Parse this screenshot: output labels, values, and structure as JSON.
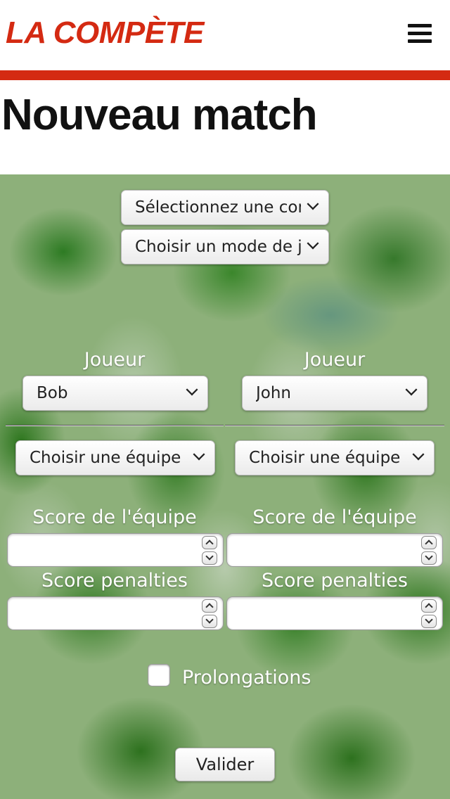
{
  "header": {
    "logo_text": "LA COMPÈTE",
    "menu_icon": "hamburger-menu-icon",
    "accent_color": "#d42a12"
  },
  "page": {
    "title": "Nouveau match"
  },
  "form": {
    "competition_select": {
      "value": "Sélectionnez une compétition"
    },
    "mode_select": {
      "value": "Choisir un mode de jeu"
    },
    "player_left": {
      "label": "Joueur",
      "value": "Bob"
    },
    "player_right": {
      "label": "Joueur",
      "value": "John"
    },
    "team_left": {
      "value": "Choisir une équipe"
    },
    "team_right": {
      "value": "Choisir une équipe"
    },
    "team_score_left": {
      "label": "Score de l'équipe",
      "value": ""
    },
    "team_score_right": {
      "label": "Score de l'équipe",
      "value": ""
    },
    "penalty_score_left": {
      "label": "Score penalties",
      "value": ""
    },
    "penalty_score_right": {
      "label": "Score penalties",
      "value": ""
    },
    "overtime": {
      "label": "Prolongations",
      "checked": false
    },
    "submit_label": "Valider"
  }
}
